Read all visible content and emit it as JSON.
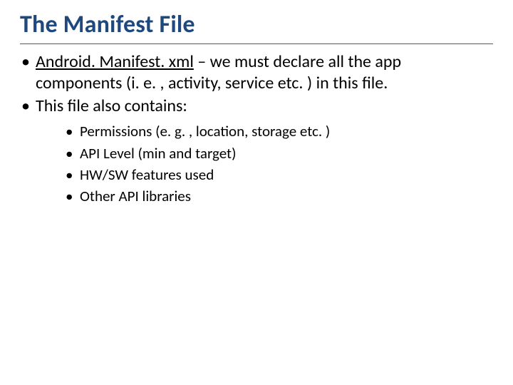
{
  "title": "The Manifest File",
  "bullets": [
    {
      "parts": [
        {
          "text": "Android. Manifest. xml",
          "underline": true
        },
        {
          "text": " – we must declare all the app components (i. e. , activity, service etc. ) in this file."
        }
      ]
    },
    {
      "parts": [
        {
          "text": "This file also contains:"
        }
      ],
      "sub": [
        "Permissions (e. g. , location, storage etc. )",
        "API Level (min and target)",
        "HW/SW features used",
        "Other API libraries"
      ]
    }
  ]
}
